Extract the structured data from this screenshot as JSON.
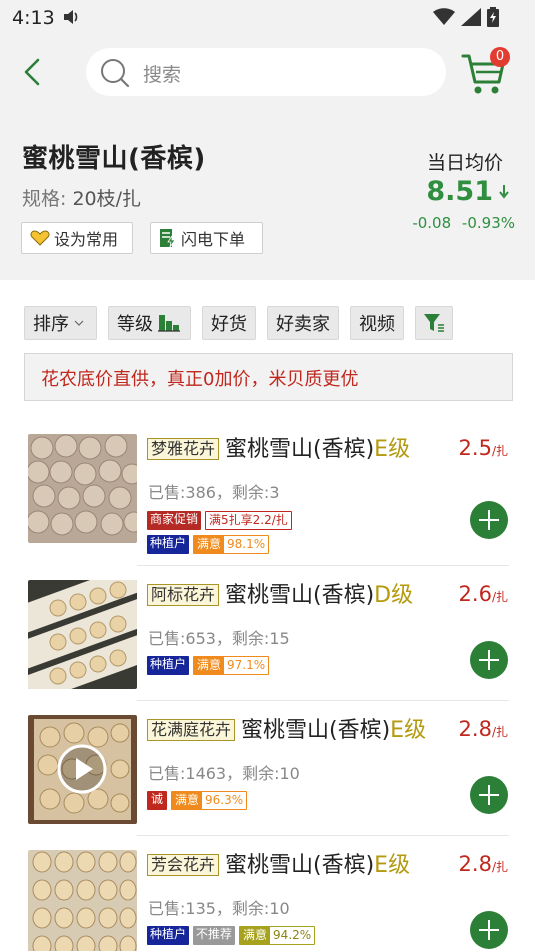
{
  "status": {
    "time": "4:13"
  },
  "search": {
    "placeholder": "搜索"
  },
  "cart": {
    "badge": "0"
  },
  "product": {
    "title": "蜜桃雪山(香槟)",
    "spec_label": "规格:",
    "spec_value": "20枝/扎",
    "fav_label": "设为常用",
    "flash_label": "闪电下单",
    "avg_label": "当日均价",
    "avg_price": "8.51",
    "avg_change": "-0.08",
    "avg_change_pct": "-0.93%"
  },
  "filters": {
    "sort": "排序",
    "grade": "等级",
    "good": "好货",
    "seller": "好卖家",
    "video": "视频"
  },
  "banner": "花农底价直供，真正0加价，米贝质更优",
  "items": [
    {
      "seller": "梦雅花卉",
      "name": "蜜桃雪山(香槟)",
      "grade": "E级",
      "price": "2.5",
      "unit": "/扎",
      "sold": "已售:386，剩余:3",
      "promo": "商家促销",
      "deal": "满5扎享2.2/扎",
      "grower": "种植户",
      "sat_label": "满意",
      "sat_value": "98.1%"
    },
    {
      "seller": "阿标花卉",
      "name": "蜜桃雪山(香槟)",
      "grade": "D级",
      "price": "2.6",
      "unit": "/扎",
      "sold": "已售:653，剩余:15",
      "grower": "种植户",
      "sat_label": "满意",
      "sat_value": "97.1%"
    },
    {
      "seller": "花满庭花卉",
      "name": "蜜桃雪山(香槟)",
      "grade": "E级",
      "price": "2.8",
      "unit": "/扎",
      "sold": "已售:1463，剩余:10",
      "honest": "诚",
      "sat_label": "满意",
      "sat_value": "96.3%"
    },
    {
      "seller": "芳会花卉",
      "name": "蜜桃雪山(香槟)",
      "grade": "E级",
      "price": "2.8",
      "unit": "/扎",
      "sold": "已售:135，剩余:10",
      "grower": "种植户",
      "notrec": "不推荐",
      "sat_label": "满意",
      "sat_value": "94.2%"
    }
  ],
  "colors": {
    "brand_green": "#2c7f37",
    "price_red": "#c0281e",
    "badge_red": "#e23b30",
    "grade_gold": "#b49a0e"
  }
}
